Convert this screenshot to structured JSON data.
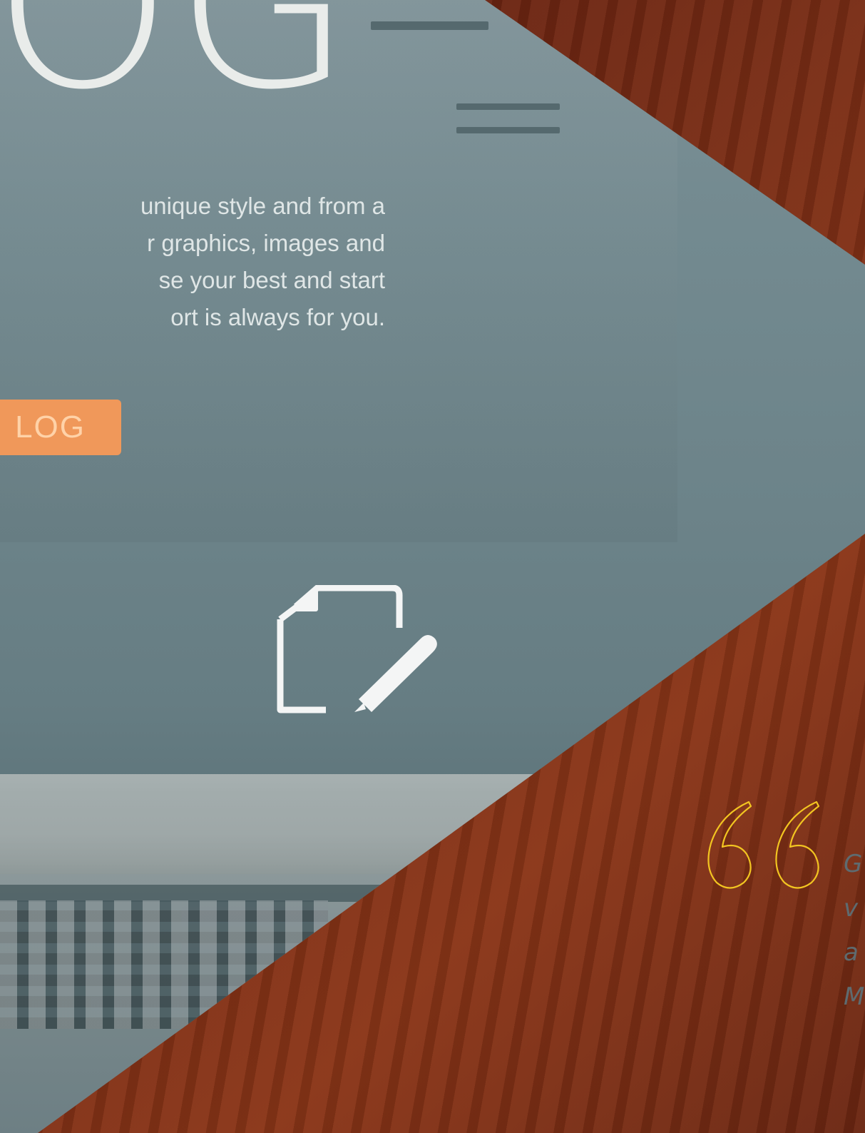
{
  "hero": {
    "heading": "OG",
    "text_lines": [
      "unique style and from a",
      "r graphics, images and",
      "se your best and start",
      "ort is always for you."
    ],
    "button_label": "LOG"
  },
  "icons": {
    "edit": "edit-document-icon",
    "quote": "quote-open-icon"
  },
  "testimonial": {
    "lines": [
      "G",
      "v",
      "a",
      "M"
    ]
  },
  "colors": {
    "accent_orange": "#f0985a",
    "quote_yellow": "#f2c521",
    "photo_teal": "#6c8389",
    "wood_brown": "#7a2d15"
  }
}
